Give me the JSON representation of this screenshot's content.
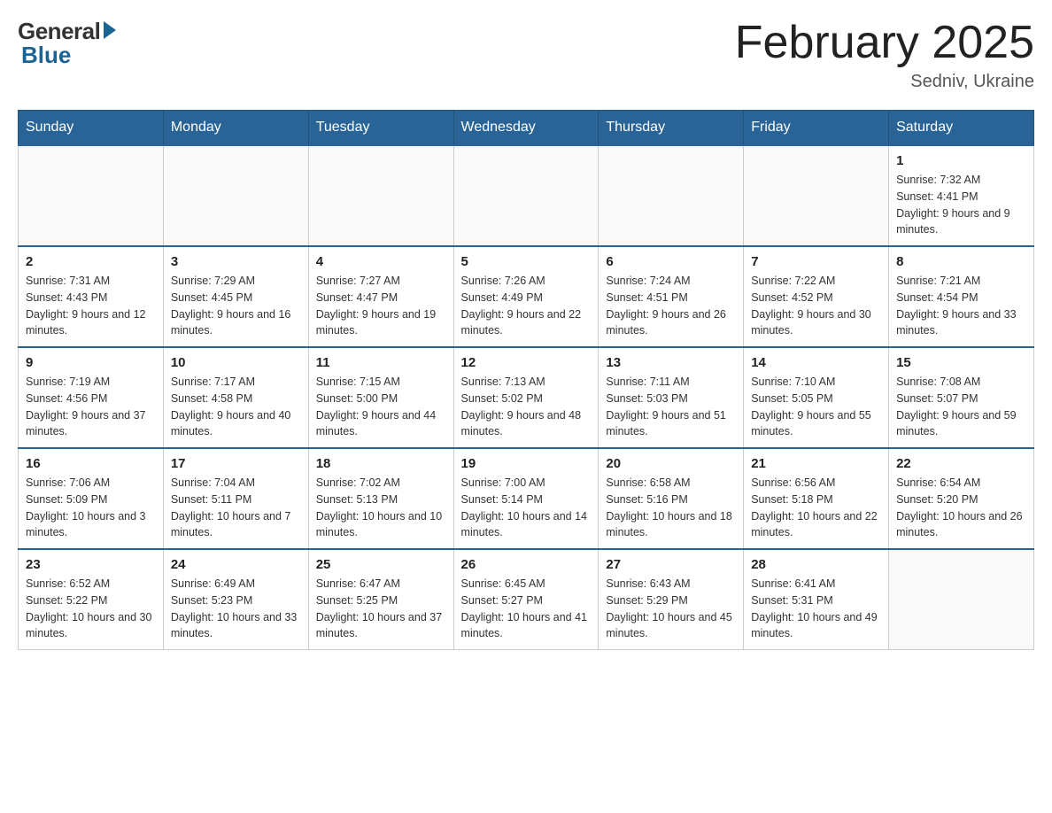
{
  "header": {
    "logo_general": "General",
    "logo_blue": "Blue",
    "month_title": "February 2025",
    "location": "Sedniv, Ukraine"
  },
  "days_of_week": [
    "Sunday",
    "Monday",
    "Tuesday",
    "Wednesday",
    "Thursday",
    "Friday",
    "Saturday"
  ],
  "weeks": [
    [
      {
        "day": "",
        "info": ""
      },
      {
        "day": "",
        "info": ""
      },
      {
        "day": "",
        "info": ""
      },
      {
        "day": "",
        "info": ""
      },
      {
        "day": "",
        "info": ""
      },
      {
        "day": "",
        "info": ""
      },
      {
        "day": "1",
        "info": "Sunrise: 7:32 AM\nSunset: 4:41 PM\nDaylight: 9 hours and 9 minutes."
      }
    ],
    [
      {
        "day": "2",
        "info": "Sunrise: 7:31 AM\nSunset: 4:43 PM\nDaylight: 9 hours and 12 minutes."
      },
      {
        "day": "3",
        "info": "Sunrise: 7:29 AM\nSunset: 4:45 PM\nDaylight: 9 hours and 16 minutes."
      },
      {
        "day": "4",
        "info": "Sunrise: 7:27 AM\nSunset: 4:47 PM\nDaylight: 9 hours and 19 minutes."
      },
      {
        "day": "5",
        "info": "Sunrise: 7:26 AM\nSunset: 4:49 PM\nDaylight: 9 hours and 22 minutes."
      },
      {
        "day": "6",
        "info": "Sunrise: 7:24 AM\nSunset: 4:51 PM\nDaylight: 9 hours and 26 minutes."
      },
      {
        "day": "7",
        "info": "Sunrise: 7:22 AM\nSunset: 4:52 PM\nDaylight: 9 hours and 30 minutes."
      },
      {
        "day": "8",
        "info": "Sunrise: 7:21 AM\nSunset: 4:54 PM\nDaylight: 9 hours and 33 minutes."
      }
    ],
    [
      {
        "day": "9",
        "info": "Sunrise: 7:19 AM\nSunset: 4:56 PM\nDaylight: 9 hours and 37 minutes."
      },
      {
        "day": "10",
        "info": "Sunrise: 7:17 AM\nSunset: 4:58 PM\nDaylight: 9 hours and 40 minutes."
      },
      {
        "day": "11",
        "info": "Sunrise: 7:15 AM\nSunset: 5:00 PM\nDaylight: 9 hours and 44 minutes."
      },
      {
        "day": "12",
        "info": "Sunrise: 7:13 AM\nSunset: 5:02 PM\nDaylight: 9 hours and 48 minutes."
      },
      {
        "day": "13",
        "info": "Sunrise: 7:11 AM\nSunset: 5:03 PM\nDaylight: 9 hours and 51 minutes."
      },
      {
        "day": "14",
        "info": "Sunrise: 7:10 AM\nSunset: 5:05 PM\nDaylight: 9 hours and 55 minutes."
      },
      {
        "day": "15",
        "info": "Sunrise: 7:08 AM\nSunset: 5:07 PM\nDaylight: 9 hours and 59 minutes."
      }
    ],
    [
      {
        "day": "16",
        "info": "Sunrise: 7:06 AM\nSunset: 5:09 PM\nDaylight: 10 hours and 3 minutes."
      },
      {
        "day": "17",
        "info": "Sunrise: 7:04 AM\nSunset: 5:11 PM\nDaylight: 10 hours and 7 minutes."
      },
      {
        "day": "18",
        "info": "Sunrise: 7:02 AM\nSunset: 5:13 PM\nDaylight: 10 hours and 10 minutes."
      },
      {
        "day": "19",
        "info": "Sunrise: 7:00 AM\nSunset: 5:14 PM\nDaylight: 10 hours and 14 minutes."
      },
      {
        "day": "20",
        "info": "Sunrise: 6:58 AM\nSunset: 5:16 PM\nDaylight: 10 hours and 18 minutes."
      },
      {
        "day": "21",
        "info": "Sunrise: 6:56 AM\nSunset: 5:18 PM\nDaylight: 10 hours and 22 minutes."
      },
      {
        "day": "22",
        "info": "Sunrise: 6:54 AM\nSunset: 5:20 PM\nDaylight: 10 hours and 26 minutes."
      }
    ],
    [
      {
        "day": "23",
        "info": "Sunrise: 6:52 AM\nSunset: 5:22 PM\nDaylight: 10 hours and 30 minutes."
      },
      {
        "day": "24",
        "info": "Sunrise: 6:49 AM\nSunset: 5:23 PM\nDaylight: 10 hours and 33 minutes."
      },
      {
        "day": "25",
        "info": "Sunrise: 6:47 AM\nSunset: 5:25 PM\nDaylight: 10 hours and 37 minutes."
      },
      {
        "day": "26",
        "info": "Sunrise: 6:45 AM\nSunset: 5:27 PM\nDaylight: 10 hours and 41 minutes."
      },
      {
        "day": "27",
        "info": "Sunrise: 6:43 AM\nSunset: 5:29 PM\nDaylight: 10 hours and 45 minutes."
      },
      {
        "day": "28",
        "info": "Sunrise: 6:41 AM\nSunset: 5:31 PM\nDaylight: 10 hours and 49 minutes."
      },
      {
        "day": "",
        "info": ""
      }
    ]
  ]
}
